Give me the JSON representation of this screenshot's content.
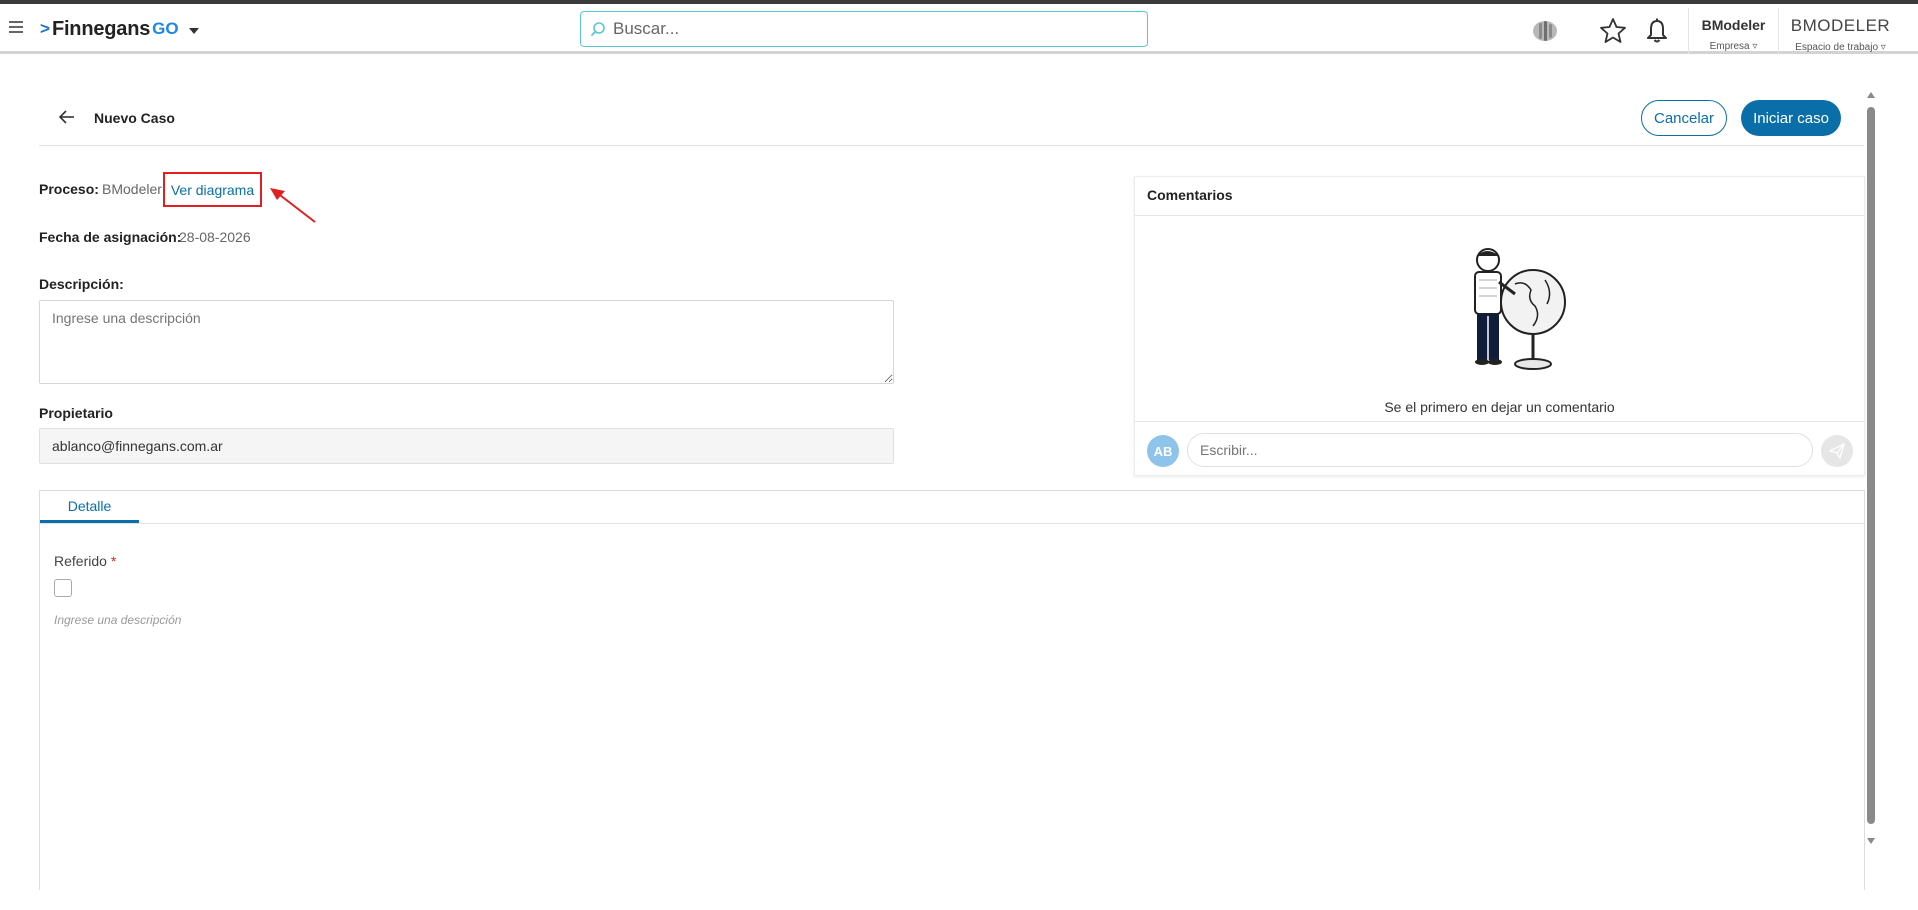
{
  "app": {
    "brand": "Finnegans",
    "brand_suffix": "GO",
    "search_placeholder": "Buscar...",
    "company_name": "BModeler",
    "company_label": "Empresa ▿",
    "workspace_name": "BMODELER",
    "workspace_label": "Espacio de trabajo ▿"
  },
  "page": {
    "title": "Nuevo Caso",
    "cancel_label": "Cancelar",
    "start_label": "Iniciar caso"
  },
  "form": {
    "process_label": "Proceso:",
    "process_value": "BModeler",
    "view_diagram": "Ver diagrama",
    "date_label": "Fecha de asignación:",
    "date_value": "28-08-2026",
    "description_label": "Descripción:",
    "description_placeholder": "Ingrese una descripción",
    "owner_label": "Propietario",
    "owner_value": "ablanco@finnegans.com.ar"
  },
  "comments": {
    "title": "Comentarios",
    "empty_text": "Se el primero en dejar un comentario",
    "avatar_initials": "AB",
    "input_placeholder": "Escribir..."
  },
  "detail": {
    "tab_label": "Detalle",
    "field_label": "Referido",
    "required_mark": "*",
    "field_hint": "Ingrese una descripción"
  },
  "colors": {
    "primary": "#0a6fa8",
    "highlight_box": "#e02020",
    "search_border": "#5bc7d6"
  }
}
